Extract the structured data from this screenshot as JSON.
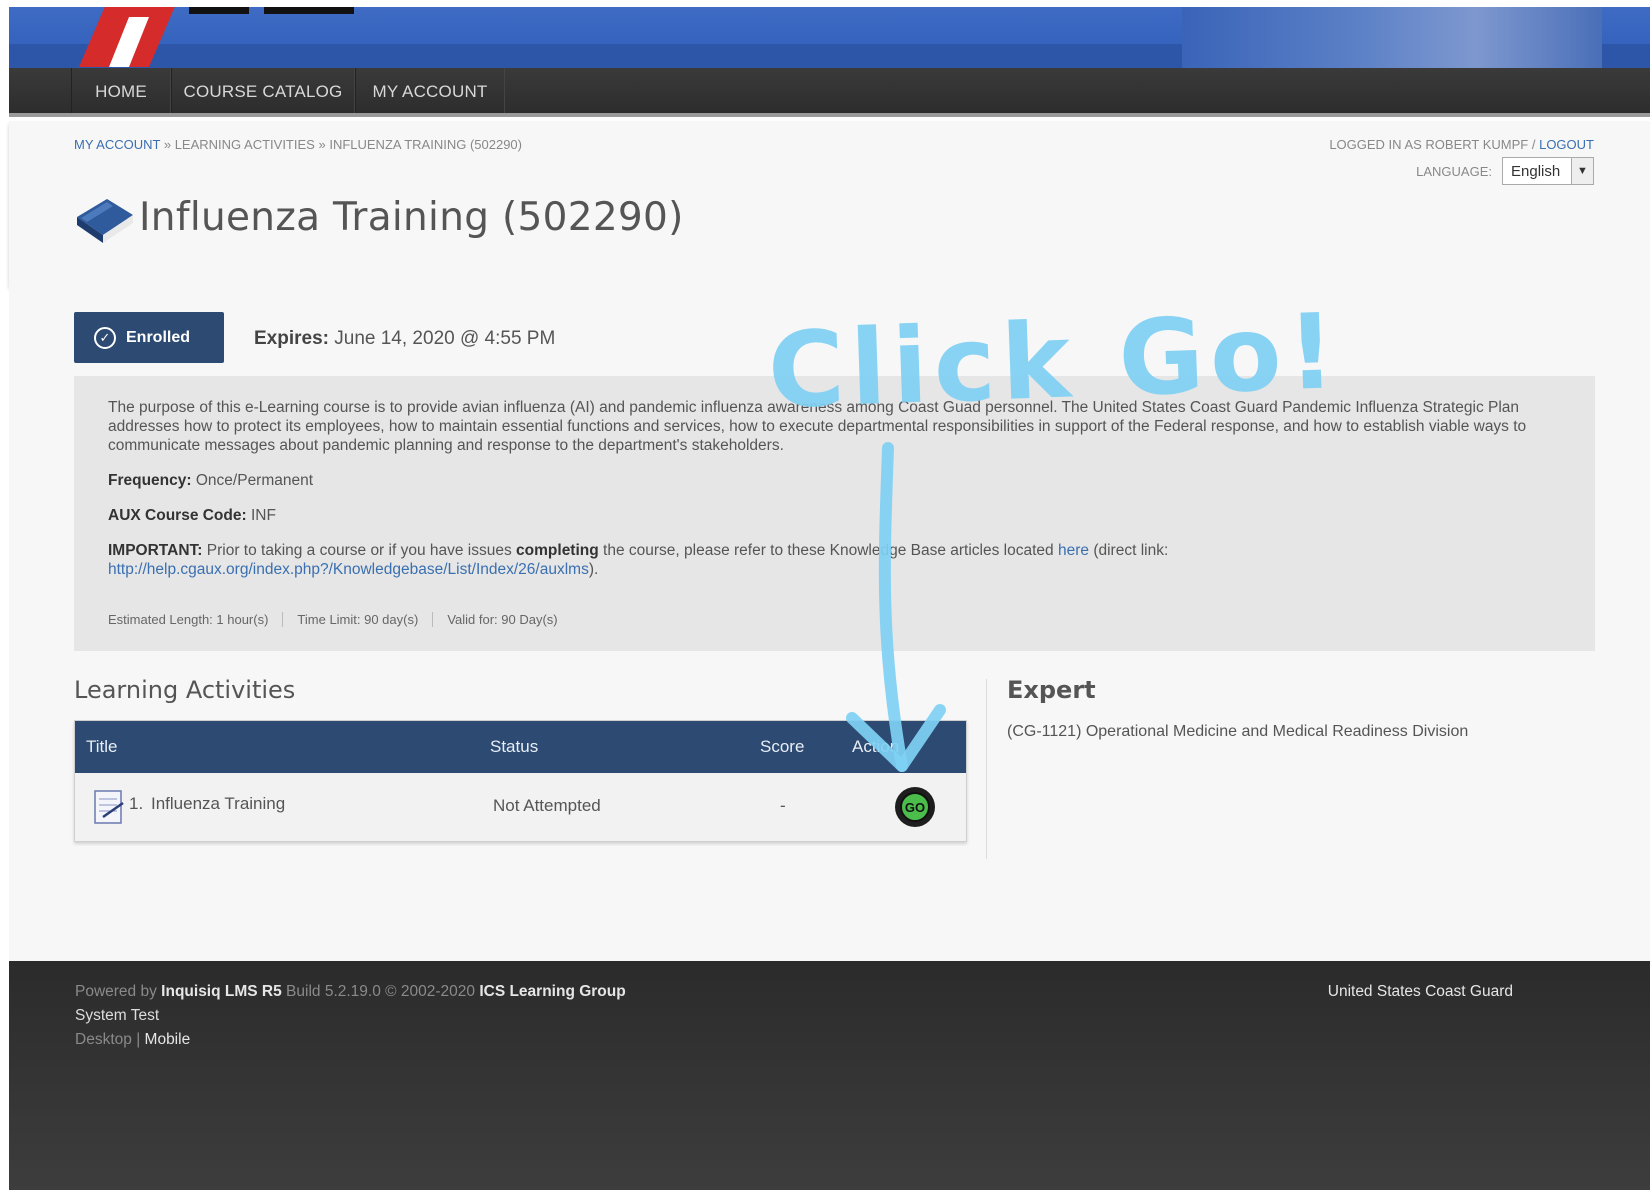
{
  "nav": {
    "items": [
      "HOME",
      "COURSE CATALOG",
      "MY ACCOUNT"
    ]
  },
  "breadcrumb": {
    "my_account": "MY ACCOUNT",
    "sep": "»",
    "learning_activities": "LEARNING ACTIVITIES",
    "current": "INFLUENZA TRAINING (502290)"
  },
  "login": {
    "prefix": "LOGGED IN AS ROBERT KUMPF",
    "sep": "/",
    "logout": "LOGOUT"
  },
  "language": {
    "label": "LANGUAGE:",
    "selected": "English"
  },
  "page_title": "Influenza Training (502290)",
  "status": {
    "badge": "Enrolled",
    "expires_label": "Expires:",
    "expires_value": "June 14, 2020 @ 4:55 PM"
  },
  "description": {
    "purpose": "The purpose of this e-Learning course is to provide avian influenza (AI) and pandemic influenza awareness among Coast Guad personnel. The United States Coast Guard Pandemic Influenza Strategic Plan addresses how to protect its employees, how to maintain essential functions and services, how to execute departmental responsibilities in support of the Federal response, and how to establish viable ways to communicate messages about pandemic planning and response to the department's stakeholders.",
    "frequency_label": "Frequency:",
    "frequency_value": "Once/Permanent",
    "aux_label": "AUX Course Code:",
    "aux_value": "INF",
    "important_label": "IMPORTANT:",
    "important_text_1": "Prior to taking a course or if you have issues",
    "important_bold": "completing",
    "important_text_2": "the course, please refer to these Knowledge Base articles located",
    "here_link": "here",
    "direct_prefix": "(direct link:",
    "direct_link": "http://help.cgaux.org/index.php?/Knowledgebase/List/Index/26/auxlms",
    "direct_suffix": ")."
  },
  "meta": {
    "length": "Estimated Length: 1 hour(s)",
    "limit": "Time Limit: 90 day(s)",
    "valid": "Valid for: 90 Day(s)"
  },
  "learning_activities": {
    "heading": "Learning Activities",
    "columns": {
      "title": "Title",
      "status": "Status",
      "score": "Score",
      "action": "Action"
    },
    "rows": [
      {
        "number": "1.",
        "title": "Influenza Training",
        "status": "Not Attempted",
        "score": "-",
        "action": "GO"
      }
    ]
  },
  "expert": {
    "heading": "Expert",
    "text": "(CG-1121) Operational Medicine and Medical Readiness Division"
  },
  "footer": {
    "powered_by": "Powered by",
    "product": "Inquisiq LMS R5",
    "build": "Build 5.2.19.0  © 2002-2020",
    "company": "ICS Learning Group",
    "system": "System Test",
    "desktop": "Desktop",
    "sep": "|",
    "mobile": "Mobile",
    "org": "United States Coast Guard"
  },
  "annotation": {
    "text": "Click Go!"
  },
  "colors": {
    "primary": "#2c4a72",
    "link": "#3a6fb0",
    "annotation": "#7fd0f4",
    "go_green": "#4bbd4b"
  }
}
